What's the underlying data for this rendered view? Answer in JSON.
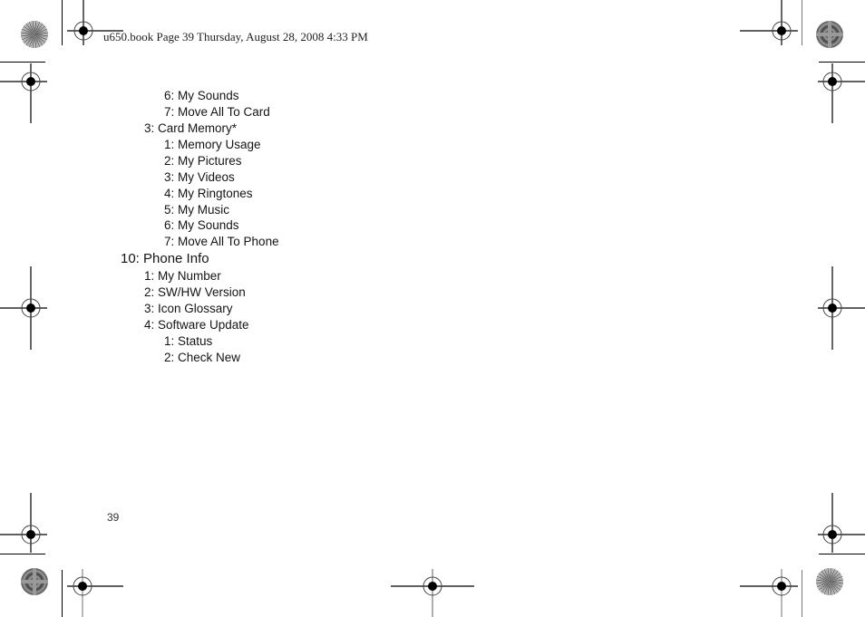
{
  "header": {
    "text": "u650.book  Page 39  Thursday, August 28, 2008  4:33 PM"
  },
  "menu_items": [
    {
      "label": "6: My Sounds",
      "level": 3
    },
    {
      "label": "7: Move All To Card",
      "level": 3
    },
    {
      "label": "3: Card Memory*",
      "level": 2
    },
    {
      "label": "1: Memory Usage",
      "level": 3
    },
    {
      "label": "2: My Pictures",
      "level": 3
    },
    {
      "label": "3: My Videos",
      "level": 3
    },
    {
      "label": "4: My Ringtones",
      "level": 3
    },
    {
      "label": "5: My Music",
      "level": 3
    },
    {
      "label": "6: My Sounds",
      "level": 3
    },
    {
      "label": "7: Move All To Phone",
      "level": 3
    },
    {
      "label": "10: Phone Info",
      "level": 1
    },
    {
      "label": "1: My Number",
      "level": 2
    },
    {
      "label": "2: SW/HW Version",
      "level": 2
    },
    {
      "label": "3: Icon Glossary",
      "level": 2
    },
    {
      "label": "4: Software Update",
      "level": 2
    },
    {
      "label": "1: Status",
      "level": 3
    },
    {
      "label": "2: Check New",
      "level": 3
    }
  ],
  "footer": {
    "page_number": "39"
  },
  "marks": {
    "registration_icon": "crosshair-registration-icon",
    "color_wheel_icon": "starburst-print-mark-icon"
  }
}
